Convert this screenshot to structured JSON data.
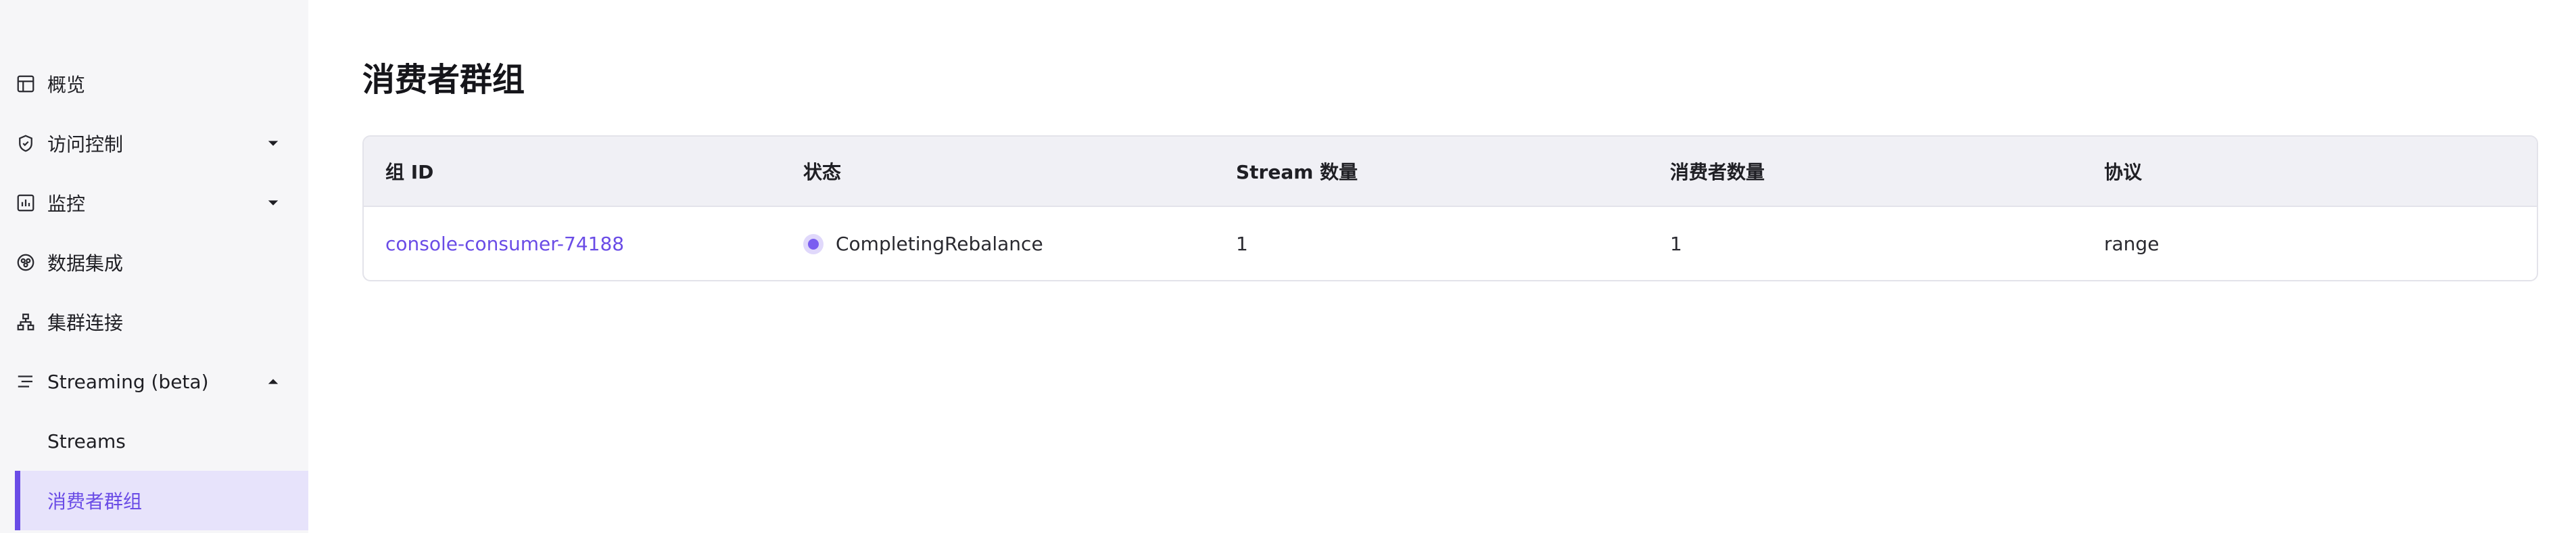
{
  "sidebar": {
    "items": [
      {
        "label": "概览",
        "icon": "dashboard-icon"
      },
      {
        "label": "访问控制",
        "icon": "shield-icon",
        "caret": "down"
      },
      {
        "label": "监控",
        "icon": "monitor-icon",
        "caret": "down"
      },
      {
        "label": "数据集成",
        "icon": "integration-icon"
      },
      {
        "label": "集群连接",
        "icon": "cluster-icon"
      },
      {
        "label": "Streaming (beta)",
        "icon": "stream-icon",
        "caret": "up"
      }
    ],
    "sub_items": [
      {
        "label": "Streams"
      },
      {
        "label": "消费者群组",
        "active": true
      }
    ]
  },
  "main": {
    "title": "消费者群组",
    "table": {
      "headers": [
        "组 ID",
        "状态",
        "Stream 数量",
        "消费者数量",
        "协议"
      ],
      "rows": [
        {
          "group_id": "console-consumer-74188",
          "status": "CompletingRebalance",
          "streams": "1",
          "consumers": "1",
          "protocol": "range"
        }
      ]
    }
  },
  "colors": {
    "accent": "#6a4ce6",
    "sidebar_bg": "#f6f6f8",
    "active_bg": "#e7e3fb",
    "header_bg": "#f0f0f5"
  }
}
